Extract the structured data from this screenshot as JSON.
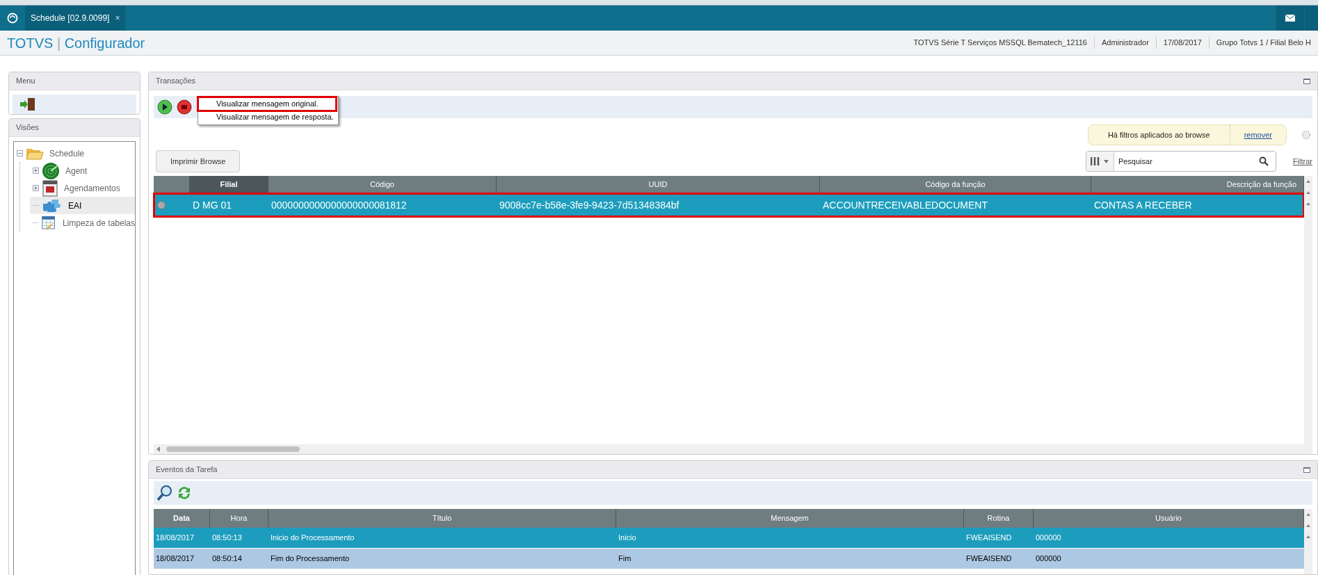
{
  "tabs": [
    {
      "label": "Schedule [02.9.0099]",
      "close": "×",
      "selected": true
    }
  ],
  "header": {
    "brand": "TOTVS",
    "separator": "|",
    "product": "Configurador",
    "info": [
      "TOTVS Série T Serviços MSSQL Bematech_12116",
      "Administrador",
      "17/08/2017",
      "Grupo Totvs 1 / Filial Belo H"
    ]
  },
  "menu_panel": {
    "title": "Menu"
  },
  "views_panel": {
    "title": "Visões",
    "tree": [
      {
        "label": "Schedule",
        "kind": "folder",
        "expanded": true,
        "selected": false,
        "children": [
          {
            "label": "Agent",
            "kind": "radar",
            "expanded": false,
            "selected": false
          },
          {
            "label": "Agendamentos",
            "kind": "calendar",
            "expanded": false,
            "selected": false
          },
          {
            "label": "EAI",
            "kind": "puzzle",
            "selected": true
          },
          {
            "label": "Limpeza de tabelas",
            "kind": "table",
            "selected": false
          }
        ]
      }
    ]
  },
  "transactions": {
    "title": "Transações",
    "popup_menu": [
      {
        "label": "Visualizar mensagem original.",
        "highlighted": true
      },
      {
        "label": "Visualizar mensagem de resposta.",
        "highlighted": false
      }
    ],
    "filter_notice": {
      "text": "Há filtros aplicados ao browse",
      "link": "remover"
    },
    "print_button": "Imprimir Browse",
    "search": {
      "placeholder": "Pesquisar"
    },
    "filter_link": "Filtrar",
    "table": {
      "columns": [
        {
          "label": "Filial",
          "selected": true
        },
        {
          "label": "Código",
          "selected": false
        },
        {
          "label": "UUID",
          "selected": false
        },
        {
          "label": "Código da função",
          "selected": false
        },
        {
          "label": "Descrição da função",
          "selected": false
        }
      ],
      "rows": [
        {
          "selected": true,
          "highlighted": true,
          "cells": [
            "D MG 01",
            "0000000000000000000081812",
            "9008cc7e-b58e-3fe9-9423-7d51348384bf",
            "ACCOUNTRECEIVABLEDOCUMENT",
            "CONTAS A RECEBER"
          ]
        }
      ]
    }
  },
  "events": {
    "title": "Eventos da Tarefa",
    "table": {
      "columns": [
        {
          "label": "Data"
        },
        {
          "label": "Hora"
        },
        {
          "label": "Título"
        },
        {
          "label": "Mensagem"
        },
        {
          "label": "Rotina"
        },
        {
          "label": "Usuário"
        }
      ],
      "rows": [
        {
          "selected": true,
          "cells": [
            "18/08/2017",
            "08:50:13",
            "Inicio do Processamento",
            "Inicio",
            "FWEAISEND",
            "000000"
          ]
        },
        {
          "selected": false,
          "cells": [
            "18/08/2017",
            "08:50:14",
            "Fim do Processamento",
            "Fim",
            "FWEAISEND",
            "000000"
          ]
        }
      ]
    }
  }
}
